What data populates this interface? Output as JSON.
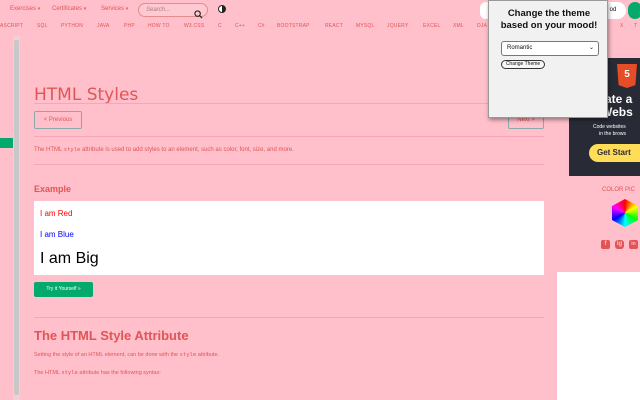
{
  "nav": {
    "menus": [
      "Exercises",
      "Certificates",
      "Services"
    ],
    "search_placeholder": "Search...",
    "right_pills": [
      "od"
    ]
  },
  "subnav": {
    "items": [
      "ASCRIPT",
      "SQL",
      "PYTHON",
      "JAVA",
      "PHP",
      "HOW TO",
      "W3.CSS",
      "C",
      "C++",
      "C#",
      "BOOTSTRAP",
      "REACT",
      "MYSQL",
      "JQUERY",
      "EXCEL",
      "XML",
      "DJA",
      "X",
      "T"
    ]
  },
  "main": {
    "title": "HTML Styles",
    "prev_label": "< Previous",
    "next_label": "Next >",
    "intro_pre": "The HTML ",
    "intro_code": "style",
    "intro_post": " attribute is used to add styles to an element, such as color, font, size, and more.",
    "example_heading": "Example",
    "example_red": "I am Red",
    "example_blue": "I am Blue",
    "example_big": "I am Big",
    "tryit_label": "Try it Yourself »",
    "section_heading": "The HTML Style Attribute",
    "p2_pre": "Setting the style of an HTML element, can be done with the ",
    "p2_code": "style",
    "p2_post": " attribute.",
    "p3_pre": "The HTML ",
    "p3_code": "style",
    "p3_post": " attribute has the following syntax:"
  },
  "sidebar_ad": {
    "badge": "5",
    "line1": "ate a",
    "line2": "Webs",
    "small1": "Code websites",
    "small2": "in the brows",
    "cta": "Get Start"
  },
  "colorpicker_label": "COLOR PIC",
  "social": [
    "f",
    "ig",
    "in"
  ],
  "theme_popup": {
    "title": "Change the theme based on your mood!",
    "selected": "Romantic",
    "apply_label": "Change Theme"
  },
  "colors": {
    "background": "#ffc0cb",
    "accent_text": "#e05555",
    "green": "#04aa6d",
    "ad_dark": "#282a35",
    "cta_yellow": "#ffdd57"
  }
}
